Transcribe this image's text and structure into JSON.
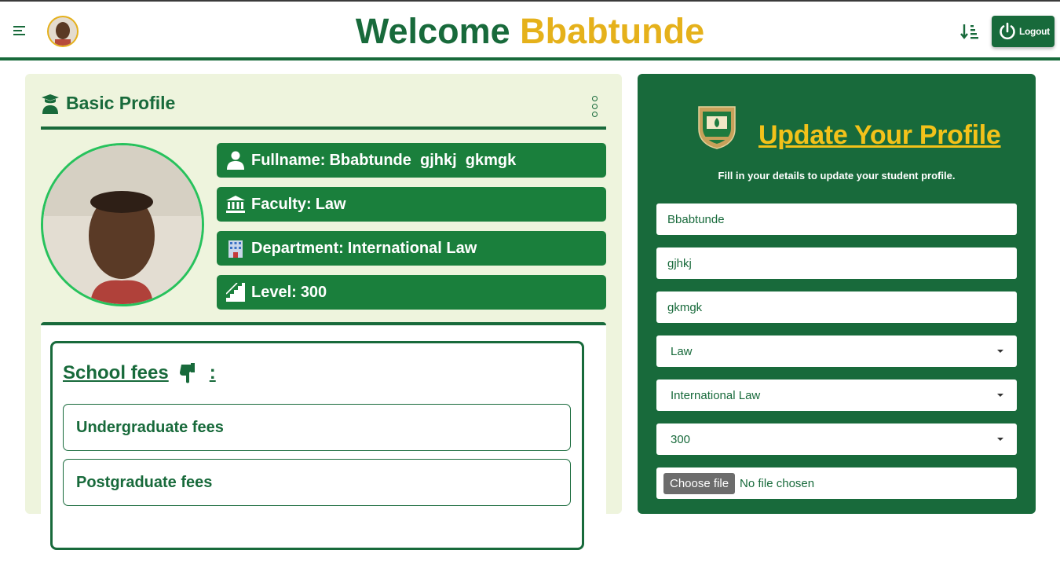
{
  "header": {
    "welcome_prefix": "Welcome",
    "welcome_name": "Bbabtunde",
    "logout_label": "Logout",
    "colors": {
      "brand_green": "#186a3b",
      "accent_yellow": "#e5b11b"
    }
  },
  "basic_profile": {
    "title": "Basic Profile",
    "fields": [
      {
        "icon": "user-icon",
        "label": "Fullname:",
        "value": "Bbabtunde  gjhkj  gkmgk"
      },
      {
        "icon": "bank-icon",
        "label": "Faculty:",
        "value": "Law"
      },
      {
        "icon": "building-icon",
        "label": "Department:",
        "value": "International Law"
      },
      {
        "icon": "stairs-icon",
        "label": "Level:",
        "value": "300"
      }
    ]
  },
  "school_fees": {
    "title": "School fees",
    "colon": ":",
    "items": [
      "Undergraduate fees",
      "Postgraduate fees"
    ]
  },
  "update_profile": {
    "title": "Update Your Profile",
    "subtitle": "Fill in your details to update your student profile.",
    "first_name": "Bbabtunde",
    "middle_name": "gjhkj",
    "last_name": "gkmgk",
    "faculty": "Law",
    "department": "International Law",
    "level": "300",
    "file_button": "Choose file",
    "file_status": "No file chosen"
  }
}
